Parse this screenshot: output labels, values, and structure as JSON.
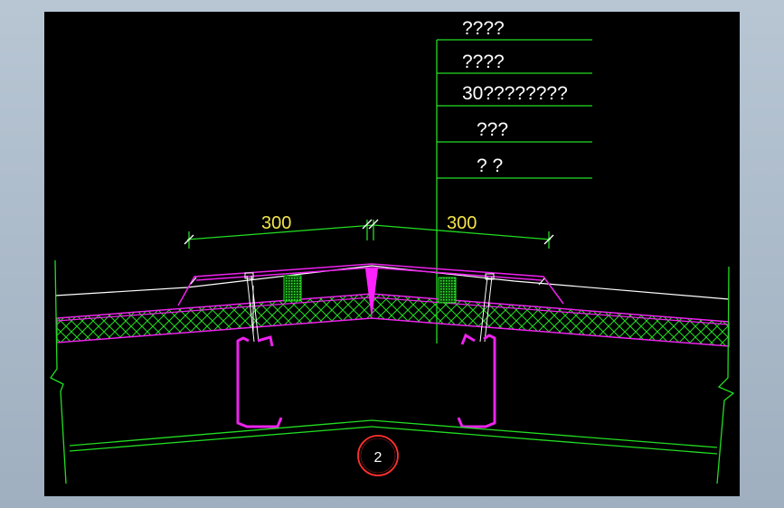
{
  "labels": {
    "leader_1": "????",
    "leader_2": "????",
    "leader_3": "30????????",
    "leader_4": "???",
    "leader_5": "?  ?",
    "dim_left": "300",
    "dim_right": "300",
    "detail_number": "2"
  },
  "colors": {
    "background": "#000000",
    "frame": "#aab8c6",
    "line_green": "#22dd22",
    "line_magenta": "#ee22ee",
    "line_white": "#ffffff",
    "text_white": "#ffffff",
    "text_yellow": "#f2e24a",
    "bubble_red": "#ff3030",
    "insulation_fill": "#22bb22"
  }
}
